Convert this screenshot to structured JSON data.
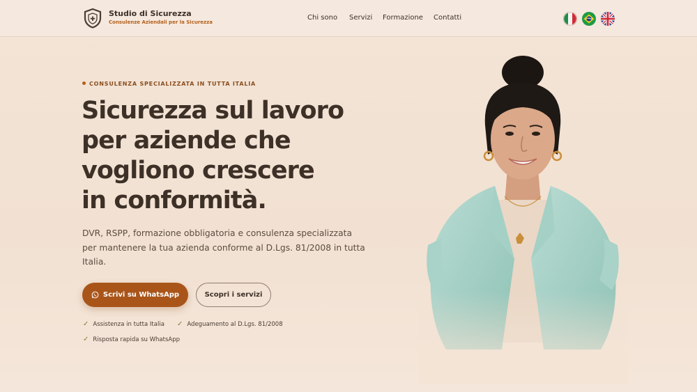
{
  "header": {
    "brand_name": "Studio di Sicurezza",
    "brand_tagline": "Consulenze Aziendali per la Sicurezza",
    "logo_icon": "shield-plus-icon",
    "nav": [
      {
        "label": "Chi sono"
      },
      {
        "label": "Servizi"
      },
      {
        "label": "Formazione"
      },
      {
        "label": "Contatti"
      }
    ],
    "languages": [
      {
        "flag": "italy-flag-icon"
      },
      {
        "flag": "brazil-flag-icon"
      },
      {
        "flag": "uk-flag-icon"
      }
    ]
  },
  "hero": {
    "eyebrow": "CONSULENZA SPECIALIZZATA IN TUTTA ITALIA",
    "headline": [
      "Sicurezza sul lavoro",
      "per aziende che",
      "vogliono crescere",
      "in conformità."
    ],
    "subtext": "DVR, RSPP, formazione obbligatoria e consulenza specializzata per mantenere la tua azienda conforme al D.Lgs. 81/2008 in tutta Italia.",
    "primary_button": "Scrivi su WhatsApp",
    "primary_button_icon": "whatsapp-icon",
    "secondary_button": "Scopri i servizi",
    "checks": [
      "Assistenza in tutta Italia",
      "Adeguamento al D.Lgs. 81/2008",
      "Risposta rapida su WhatsApp"
    ]
  },
  "colors": {
    "accent": "#a9551a",
    "accent_text": "#b5601b",
    "background": "#f3e4d6",
    "text_dark": "#3d3027"
  }
}
